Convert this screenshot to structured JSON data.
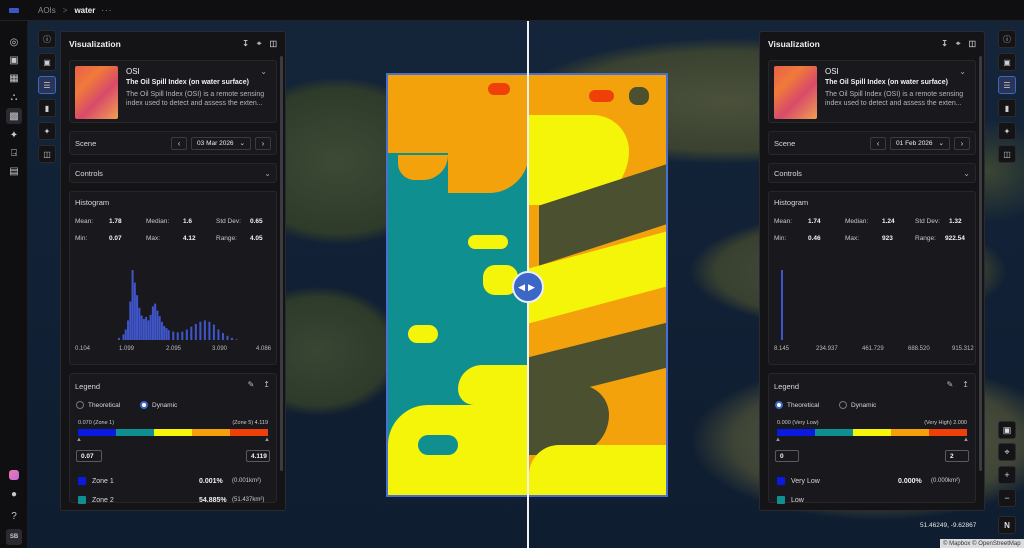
{
  "breadcrumb": {
    "root": "AOIs",
    "separator": ">",
    "current": "water",
    "more": "···"
  },
  "user_initials": "SB",
  "panels": [
    {
      "title": "Visualization",
      "layer": {
        "name": "OSI",
        "subtitle": "The Oil Spill Index (on water surface)",
        "description": "The Oil Spill Index (OSI) is a remote sensing index used to detect and assess the exten..."
      },
      "scene": {
        "label": "Scene",
        "date": "03 Mar 2026"
      },
      "controls_label": "Controls",
      "histogram": {
        "title": "Histogram",
        "stats": [
          {
            "label": "Mean:",
            "value": "1.78"
          },
          {
            "label": "Median:",
            "value": "1.6"
          },
          {
            "label": "Std Dev:",
            "value": "0.65"
          },
          {
            "label": "Min:",
            "value": "0.07"
          },
          {
            "label": "Max:",
            "value": "4.12"
          },
          {
            "label": "Range:",
            "value": "4.05"
          }
        ],
        "ticks": [
          "0.104",
          "1.099",
          "2.095",
          "3.090",
          "4.086"
        ]
      },
      "legend": {
        "title": "Legend",
        "mode_theoretical": "Theoretical",
        "mode_dynamic": "Dynamic",
        "selected_mode": "Dynamic",
        "range_left": "0.070 (Zone 1)",
        "range_right": "(Zone 5) 4.119",
        "min_value": "0.07",
        "max_value": "4.119",
        "rows": [
          {
            "name": "Zone 1",
            "pct": "0.001%",
            "area": "(0.001km²)",
            "color": "#0a1ae0"
          },
          {
            "name": "Zone 2",
            "pct": "54.885%",
            "area": "(51.437km²)",
            "color": "#0f8f8f"
          }
        ]
      }
    },
    {
      "title": "Visualization",
      "layer": {
        "name": "OSI",
        "subtitle": "The Oil Spill Index (on water surface)",
        "description": "The Oil Spill Index (OSI) is a remote sensing index used to detect and assess the exten..."
      },
      "scene": {
        "label": "Scene",
        "date": "01 Feb 2026"
      },
      "controls_label": "Controls",
      "histogram": {
        "title": "Histogram",
        "stats": [
          {
            "label": "Mean:",
            "value": "1.74"
          },
          {
            "label": "Median:",
            "value": "1.24"
          },
          {
            "label": "Std Dev:",
            "value": "1.32"
          },
          {
            "label": "Min:",
            "value": "0.46"
          },
          {
            "label": "Max:",
            "value": "923"
          },
          {
            "label": "Range:",
            "value": "922.54"
          }
        ],
        "ticks": [
          "8.145",
          "234.937",
          "461.729",
          "688.520",
          "915.312"
        ]
      },
      "legend": {
        "title": "Legend",
        "mode_theoretical": "Theoretical",
        "mode_dynamic": "Dynamic",
        "selected_mode": "Theoretical",
        "range_left": "0.000 (Very Low)",
        "range_right": "(Very High) 2.000",
        "min_value": "0",
        "max_value": "2",
        "rows": [
          {
            "name": "Very Low",
            "pct": "0.000%",
            "area": "(0.000km²)",
            "color": "#0a1ae0"
          },
          {
            "name": "Low",
            "pct": "",
            "area": "",
            "color": "#0f8f8f"
          }
        ]
      }
    }
  ],
  "ramp_colors": [
    "#0a1ae0",
    "#0f8f8f",
    "#f5f50a",
    "#f5a00a",
    "#f0400a"
  ],
  "map": {
    "coords": "51.46249, -9.62867",
    "attribution": "© Mapbox © OpenStreetMap",
    "compass": "N"
  },
  "chart_data": [
    {
      "type": "bar",
      "title": "Histogram",
      "xlim": [
        0.104,
        4.086
      ],
      "x": [
        0.9,
        1.0,
        1.05,
        1.1,
        1.15,
        1.2,
        1.25,
        1.3,
        1.35,
        1.4,
        1.45,
        1.5,
        1.55,
        1.6,
        1.65,
        1.7,
        1.75,
        1.8,
        1.85,
        1.9,
        1.95,
        2.0,
        2.1,
        2.2,
        2.3,
        2.4,
        2.5,
        2.6,
        2.7,
        2.8,
        2.9,
        3.0,
        3.1,
        3.2,
        3.3,
        3.4,
        3.5
      ],
      "values": [
        3,
        8,
        15,
        28,
        55,
        100,
        82,
        64,
        46,
        35,
        30,
        33,
        28,
        36,
        48,
        52,
        42,
        34,
        26,
        20,
        17,
        14,
        12,
        11,
        12,
        15,
        19,
        23,
        26,
        28,
        26,
        22,
        15,
        10,
        6,
        3,
        1
      ]
    },
    {
      "type": "bar",
      "title": "Histogram",
      "xlim": [
        8.145,
        915.312
      ],
      "x": [
        8.145
      ],
      "values": [
        100
      ]
    }
  ]
}
